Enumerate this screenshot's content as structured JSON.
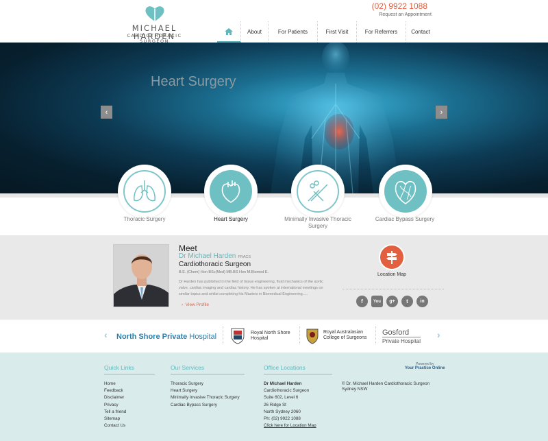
{
  "header": {
    "logo_name": "MICHAEL HARDEN",
    "logo_sub": "CARDIOTHORACIC SURGEON",
    "phone": "(02) 9922 1088",
    "appointment": "Request an Appointment",
    "nav": [
      "About",
      "For Patients",
      "First Visit",
      "For Referrers",
      "Contact"
    ]
  },
  "hero": {
    "title": "Heart Surgery",
    "prev": "‹",
    "next": "›"
  },
  "services": [
    {
      "label": "Thoracic Surgery",
      "icon": "lungs-icon"
    },
    {
      "label": "Heart Surgery",
      "icon": "heart-icon"
    },
    {
      "label": "Minimally Invasive Thoracic Surgery",
      "icon": "surgical-instruments-icon"
    },
    {
      "label": "Cardiac Bypass Surgery",
      "icon": "bypass-heart-icon"
    }
  ],
  "meet": {
    "title": "Meet",
    "name": "Dr Michael Harden",
    "fracs": "FRACS",
    "role": "Cardiothoracic Surgeon",
    "quals": "B.E. (Chem) Hon BSc(Med) MB.BS Hon M.Biomed E.",
    "bio": "Dr Harden has published in the field of tissue engineering, fluid mechanics of the aortic valve, cardiac imaging and cardiac history. He has spoken at international meetings on similar topics and whilst completing his Masters in Biomedical Engineering.....",
    "view_profile": "View Profile",
    "location_map": "Location Map"
  },
  "partners": {
    "nshp_bold": "North Shore Private",
    "nshp_rest": "Hospital",
    "rnsh_1": "Royal North Shore",
    "rnsh_2": "Hospital",
    "racs_1": "Royal Australasian",
    "racs_2": "College of Surgeons",
    "gosford_1": "Gosford",
    "gosford_2": "Private Hospital"
  },
  "footer": {
    "quick_links_title": "Quick Links",
    "quick_links": [
      "Home",
      "Feedback",
      "Disclaimer",
      "Privacy",
      "Tell a friend",
      "Sitemap",
      "Contact Us"
    ],
    "services_title": "Our Services",
    "services_links": [
      "Thoracic Surgery",
      "Heart Surgery",
      "Minimally Invasive Thoracic Surgery",
      "Cardiac Bypass Surgery"
    ],
    "offices_title": "Office Locations",
    "office_name": "Dr Michael Harden",
    "office_lines": [
      "Cardiothoracic Surgeon",
      "Suite 602, Level 6",
      "26 Ridge St",
      "North Sydney 2060",
      "Ph: (02) 9922 1088"
    ],
    "office_map_link": "Click here for Location Map",
    "ypo_small": "Powered by",
    "ypo_brand": "Your Practice Online",
    "copyright_1": "© Dr. Michael Harden Cardiothoracic Surgeon",
    "copyright_2": "Sydney NSW"
  },
  "colors": {
    "accent": "#5fb8bd",
    "orange": "#e2603f",
    "footer_bg": "#d9ebeb"
  }
}
